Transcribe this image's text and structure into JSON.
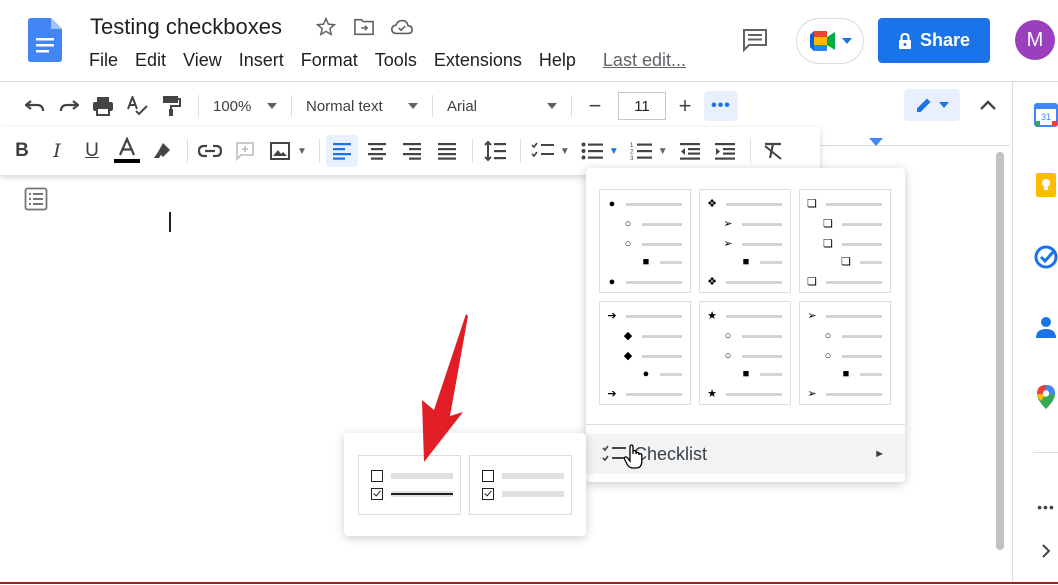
{
  "app": {
    "doc_title": "Testing checkboxes",
    "menu": [
      "File",
      "Edit",
      "View",
      "Insert",
      "Format",
      "Tools",
      "Extensions",
      "Help"
    ],
    "last_edit": "Last edit...",
    "share_label": "Share",
    "avatar_initial": "M",
    "brand_color": "#1a73e8"
  },
  "toolbar": {
    "zoom": "100%",
    "style": "Normal text",
    "font": "Arial",
    "font_size": "11",
    "minus": "−",
    "plus": "+",
    "more": "•••"
  },
  "bullet_menu": {
    "presets": [
      [
        "●",
        "○",
        "○",
        "■",
        "●"
      ],
      [
        "❖",
        "➢",
        "➢",
        "■",
        "❖"
      ],
      [
        "❏",
        "❏",
        "❏",
        "❏",
        "❏"
      ],
      [
        "➔",
        "◆",
        "◆",
        "●",
        "➔"
      ],
      [
        "★",
        "○",
        "○",
        "■",
        "★"
      ],
      [
        "➢",
        "○",
        "○",
        "■",
        "➢"
      ]
    ],
    "checklist_label": "Checklist",
    "submenu_arrow": "►"
  },
  "checklist_submenu": {
    "options": [
      "checklist-strikethrough",
      "checklist-plain"
    ]
  },
  "side_panel": {
    "calendar_day": "31"
  }
}
